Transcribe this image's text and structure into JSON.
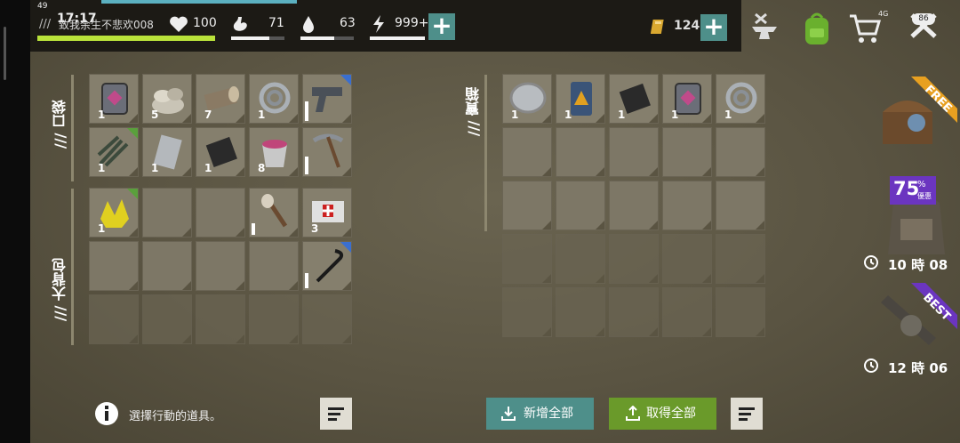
{
  "status_bar": {
    "time": "17:17",
    "signal_small": "49",
    "net_label": "4G",
    "battery": "86"
  },
  "player": {
    "name": "致我余生不悲欢008"
  },
  "stats": {
    "health": "100",
    "food": "71",
    "water": "63",
    "energy": "999+",
    "health_level": 1.0,
    "food_level": 0.71,
    "water_level": 0.63,
    "energy_level": 1.0
  },
  "currency": {
    "gold": "124"
  },
  "sections": {
    "pocket_label": "/// 口袋",
    "backpack_label": "/// 大背包",
    "chest_label": "/// 寶箱"
  },
  "pocket_items": [
    {
      "icon": "gas-can-icon",
      "count": "1"
    },
    {
      "icon": "stone-pile-icon",
      "count": "5"
    },
    {
      "icon": "log-icon",
      "count": "7"
    },
    {
      "icon": "rope-coil-icon",
      "count": "1"
    },
    {
      "icon": "pistol-icon",
      "count": "",
      "durability": 0.7,
      "corner": "#3a6fd0"
    },
    {
      "icon": "nails-icon",
      "count": "1",
      "corner": "#5aa03c"
    },
    {
      "icon": "metal-plate-icon",
      "count": "1"
    },
    {
      "icon": "rubber-sheet-icon",
      "count": "1"
    },
    {
      "icon": "berry-bucket-icon",
      "count": "8"
    },
    {
      "icon": "pickaxe-icon",
      "count": "",
      "durability": 0.6
    }
  ],
  "backpack_items": [
    {
      "icon": "ore-crystals-icon",
      "count": "1",
      "corner": "#5aa03c"
    },
    {
      "icon": "",
      "count": ""
    },
    {
      "icon": "",
      "count": ""
    },
    {
      "icon": "torch-icon",
      "count": "",
      "durability": 0.35
    },
    {
      "icon": "first-aid-bandage-icon",
      "count": "3"
    },
    {
      "icon": "",
      "count": ""
    },
    {
      "icon": "",
      "count": ""
    },
    {
      "icon": "",
      "count": ""
    },
    {
      "icon": "",
      "count": ""
    },
    {
      "icon": "crowbar-icon",
      "count": "",
      "durability": 0.5,
      "corner": "#3a6fd0"
    }
  ],
  "chest_items": [
    {
      "icon": "lens-icon",
      "count": "1"
    },
    {
      "icon": "fuel-barrel-icon",
      "count": "1"
    },
    {
      "icon": "rubber-sheet-icon",
      "count": "1"
    },
    {
      "icon": "gas-can-icon",
      "count": "1"
    },
    {
      "icon": "rope-coil-icon",
      "count": "1"
    }
  ],
  "hint": {
    "text": "選擇行動的道具。"
  },
  "buttons": {
    "deposit_all": "新增全部",
    "take_all": "取得全部"
  },
  "offers": {
    "free_label": "FREE",
    "discount_label": "75",
    "discount_suffix": "%",
    "discount_sub": "優惠",
    "discount_timer": "10 時 08",
    "best_label": "BEST",
    "best_timer": "12 時 06"
  },
  "colors": {
    "accent_teal": "#4e8f8a",
    "accent_green": "#6a9a2a",
    "offer_purple": "#6b35c0",
    "offer_gold": "#e8a020"
  }
}
